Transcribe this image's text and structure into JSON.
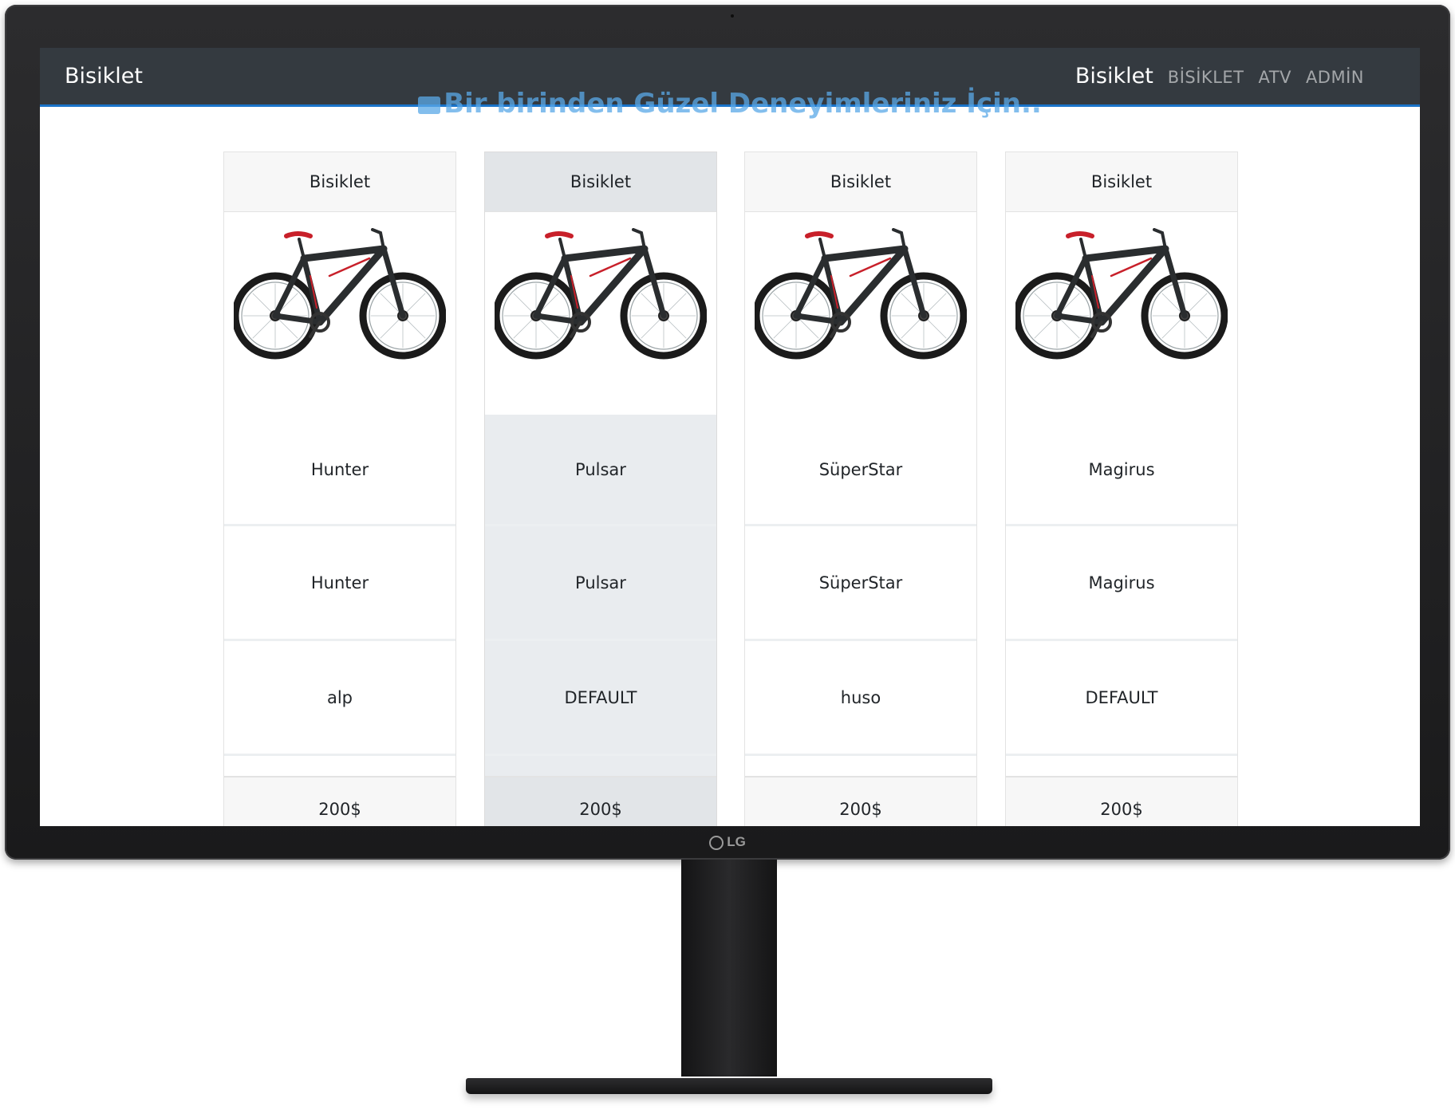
{
  "monitor": {
    "brand": "LG"
  },
  "navbar": {
    "brand": "Bisiklet",
    "active": "Bisiklet",
    "links": [
      "BİSİKLET",
      "ATV",
      "ADMİN"
    ]
  },
  "tagline": "Bir birinden Güzel Deneyimleriniz İçin..",
  "cards": [
    {
      "header": "Bisiklet",
      "image": "bicycle-image",
      "name": "Hunter",
      "model": "Hunter",
      "owner": "alp",
      "price": "200$"
    },
    {
      "header": "Bisiklet",
      "image": "bicycle-image",
      "name": "Pulsar",
      "model": "Pulsar",
      "owner": "DEFAULT",
      "price": "200$"
    },
    {
      "header": "Bisiklet",
      "image": "bicycle-image",
      "name": "SüperStar",
      "model": "SüperStar",
      "owner": "huso",
      "price": "200$"
    },
    {
      "header": "Bisiklet",
      "image": "bicycle-image",
      "name": "Magirus",
      "model": "Magirus",
      "owner": "DEFAULT",
      "price": "200$"
    }
  ],
  "colors": {
    "navbar": "#343a40",
    "accent": "#1a73c9",
    "tagline": "#5aa9e8",
    "highlight_card": "#e9ecef"
  }
}
